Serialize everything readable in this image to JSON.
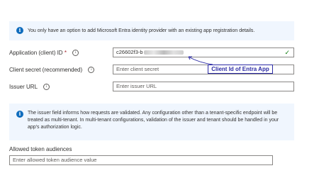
{
  "top_info": {
    "icon": "info-icon",
    "text": "You only have an option to add Microsoft Entra identity provider with an existing app registration details."
  },
  "fields": {
    "client_id": {
      "label": "Application (client) ID",
      "required_mark": "*",
      "value_prefix": "c26602f3-b",
      "status_icon": "check-icon"
    },
    "client_secret": {
      "label": "Client secret (recommended)",
      "placeholder": "Enter client secret"
    },
    "issuer_url": {
      "label": "Issuer URL",
      "placeholder": "Enter issuer URL"
    },
    "allowed_audiences": {
      "label": "Allowed token audiences",
      "placeholder": "Enter allowed token audience value"
    }
  },
  "annotation": {
    "text": "Client Id of Entra App",
    "color": "#2b2aa4"
  },
  "issuer_info": {
    "icon": "info-icon",
    "text": "The issuer field informs how requests are validated. Any configuration other than a tenant-specific endpoint will be treated as multi-tenant. In multi-tenant configurations, validation of the issuer and tenant should be handled in your app's authorization logic."
  },
  "colors": {
    "info_background": "#f0f6fe",
    "info_icon": "#0f6cbd",
    "required": "#a4262c",
    "valid": "#107c10"
  }
}
